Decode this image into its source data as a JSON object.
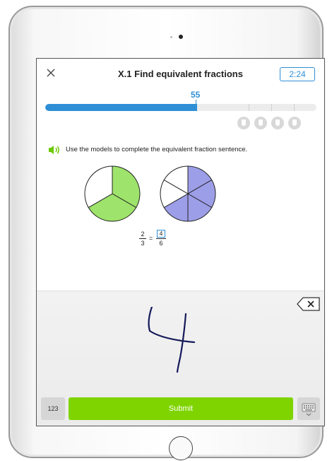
{
  "header": {
    "title": "X.1 Find equivalent fractions",
    "timer": "2:24"
  },
  "progress": {
    "score": "55",
    "fill_fraction": 0.56
  },
  "awards": [
    "award-icon",
    "award-icon",
    "award-icon",
    "award-icon"
  ],
  "question": {
    "prompt": "Use the models to complete the equivalent fraction sentence.",
    "models": [
      {
        "slices": 3,
        "shaded": 2,
        "shade_color": "#9ee36b"
      },
      {
        "slices": 6,
        "shaded": 4,
        "shade_color": "#9d9ee8"
      }
    ],
    "left_fraction": {
      "numerator": "2",
      "denominator": "3"
    },
    "equals": "=",
    "right_fraction": {
      "numerator": "4",
      "denominator": "6"
    }
  },
  "input_panel": {
    "handwritten_value": "4",
    "mode_button_label": "123",
    "submit_label": "Submit"
  },
  "colors": {
    "accent": "#2e8fd6",
    "submit": "#7fd400",
    "speaker": "#6cc800"
  }
}
